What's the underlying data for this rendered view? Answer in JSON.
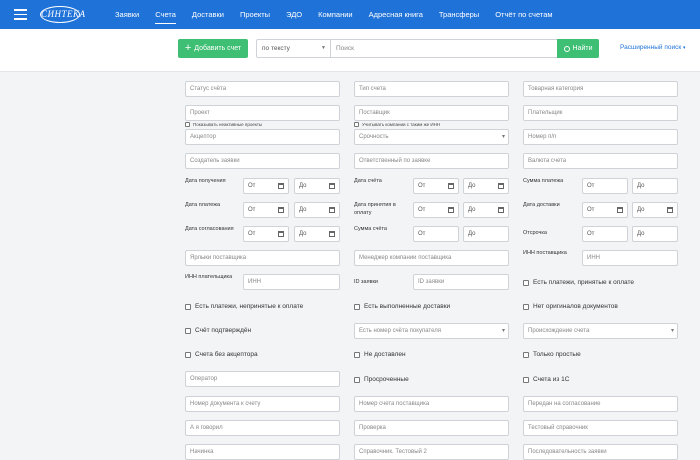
{
  "nav": {
    "logo_text": "СИНТЕКА",
    "items": [
      {
        "label": "Заявки",
        "active": false
      },
      {
        "label": "Счета",
        "active": true
      },
      {
        "label": "Доставки",
        "active": false
      },
      {
        "label": "Проекты",
        "active": false
      },
      {
        "label": "ЭДО",
        "active": false
      },
      {
        "label": "Компании",
        "active": false
      },
      {
        "label": "Адресная книга",
        "active": false
      },
      {
        "label": "Трансферы",
        "active": false
      },
      {
        "label": "Отчёт по счетам",
        "active": false
      }
    ]
  },
  "toolbar": {
    "add_label": "Добавить счет",
    "search_type": "по тексту",
    "search_placeholder": "Поиск",
    "find_label": "Найти",
    "advanced_label": "Расширенный поиск"
  },
  "filters": {
    "status": "Статус счёта",
    "type": "Тип счета",
    "category": "Товарная категория",
    "project": "Проект",
    "supplier": "Поставщик",
    "payer": "Плательщик",
    "show_inactive": "Показывать неактивные проекты",
    "inn_companies": "Учитывать компании с таким же ИНН",
    "acceptor": "Акцептор",
    "urgency": "Срочность",
    "number": "Номер п/п",
    "creator": "Создатель заявки",
    "responsible": "Ответственный по заявке",
    "currency": "Валюта счета",
    "date_received": "Дата получения",
    "date_invoice": "Дата счёта",
    "amount_payment": "Сумма платежа",
    "date_payment": "Дата платежа",
    "date_accept_payment": "Дата принятия в оплату",
    "date_delivery": "Дата доставки",
    "date_approval": "Дата согласования",
    "amount_invoice": "Сумма счёта",
    "deferral": "Отсрочка",
    "from": "От",
    "to": "До",
    "supplier_tags": "Ярлыки поставщика",
    "supplier_manager": "Менеджер компании поставщика",
    "supplier_inn_label": "ИНН поставщика",
    "inn": "ИНН",
    "payer_inn_label": "ИНН плательщика",
    "request_id_label": "ID заявки",
    "request_id": "ID заявки",
    "accepted_payments": "Есть платежи, принятые к оплате",
    "unaccepted_payments": "Есть платежи, непринятые к оплате",
    "done_deliveries": "Есть выполненные доставки",
    "no_originals": "Нет оригиналов документов",
    "confirmed": "Счёт подтверждён",
    "buyer_number": "Есть номер счёта покупателя",
    "invoice_origin": "Происхождение счета",
    "no_acceptor": "Счета без акцептора",
    "not_delivered": "Не доставлен",
    "simple_only": "Только простые",
    "operator": "Оператор",
    "overdue": "Просроченные",
    "from_1c": "Счета из 1С",
    "doc_number": "Номер документа к счету",
    "supplier_invoice_number": "Номер счета поставщика",
    "sent_approval": "Передан на согласование",
    "said_a": "А я говорил",
    "check": "Проверка",
    "test_ref": "Тестовый справочник",
    "nachinka": "Начинка",
    "reference_test": "Справочник. Тестовый 2",
    "delivery_seq": "Последовательность заявки"
  }
}
